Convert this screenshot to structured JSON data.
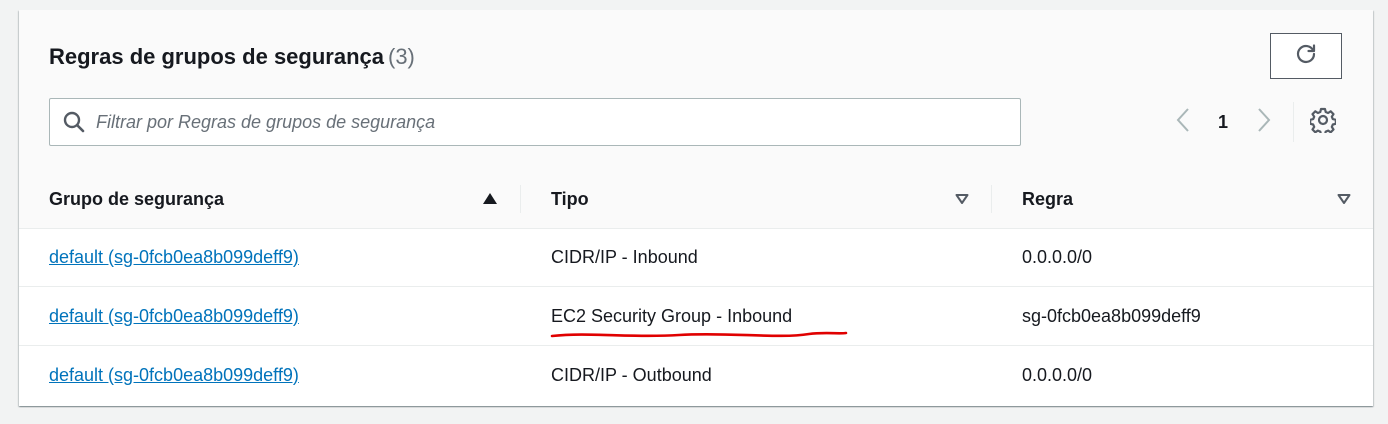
{
  "header": {
    "title": "Regras de grupos de segurança",
    "count": "(3)"
  },
  "toolbar": {
    "refresh_icon": "refresh-icon"
  },
  "search": {
    "placeholder": "Filtrar por Regras de grupos de segurança",
    "value": "",
    "icon": "search-icon"
  },
  "pagination": {
    "current_page": "1",
    "prev_icon": "chevron-left-icon",
    "next_icon": "chevron-right-icon"
  },
  "settings": {
    "icon": "gear-icon"
  },
  "table": {
    "columns": [
      {
        "label": "Grupo de segurança",
        "sort": "ascending"
      },
      {
        "label": "Tipo",
        "sort": "none"
      },
      {
        "label": "Regra",
        "sort": "none"
      }
    ],
    "rows": [
      {
        "group": "default (sg-0fcb0ea8b099deff9)",
        "type": "CIDR/IP - Inbound",
        "rule": "0.0.0.0/0"
      },
      {
        "group": "default (sg-0fcb0ea8b099deff9)",
        "type": "EC2 Security Group - Inbound",
        "rule": "sg-0fcb0ea8b099deff9"
      },
      {
        "group": "default (sg-0fcb0ea8b099deff9)",
        "type": "CIDR/IP - Outbound",
        "rule": "0.0.0.0/0"
      }
    ]
  },
  "colors": {
    "link": "#0073bb",
    "annotation": "#e00000",
    "text": "#16191f",
    "muted": "#687078"
  }
}
